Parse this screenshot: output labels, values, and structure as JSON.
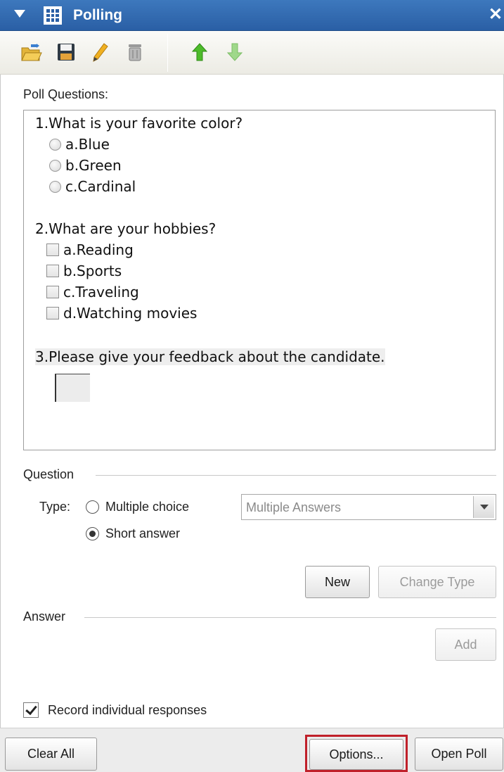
{
  "panel": {
    "title": "Polling",
    "close_glyph": "✕"
  },
  "toolbar": {
    "icons": [
      "open-folder-icon",
      "save-icon",
      "edit-pencil-icon",
      "delete-trash-icon",
      "move-up-arrow-icon",
      "move-down-arrow-icon"
    ]
  },
  "poll_questions": {
    "label": "Poll Questions:",
    "q1": {
      "text": "1.What is your favorite color?",
      "options": [
        "a.Blue",
        "b.Green",
        "c.Cardinal"
      ]
    },
    "q2": {
      "text": "2.What are your hobbies?",
      "options": [
        "a.Reading",
        "b.Sports",
        "c.Traveling",
        "d.Watching movies"
      ]
    },
    "q3": {
      "text": "3.Please give your feedback about the candidate."
    }
  },
  "question_section": {
    "heading": "Question",
    "type_label": "Type:",
    "multiple_choice": "Multiple choice",
    "short_answer": "Short answer",
    "selected_type": "Short answer",
    "dropdown_value": "Multiple  Answers",
    "new_button": "New",
    "change_type_button": "Change Type"
  },
  "answer_section": {
    "heading": "Answer",
    "add_button": "Add"
  },
  "record": {
    "label": "Record individual responses",
    "checked": true
  },
  "bottom": {
    "clear_all": "Clear All",
    "options": "Options...",
    "open_poll": "Open Poll"
  },
  "colors": {
    "titlebar": "#2a5fa5",
    "highlight": "#c0202a"
  }
}
